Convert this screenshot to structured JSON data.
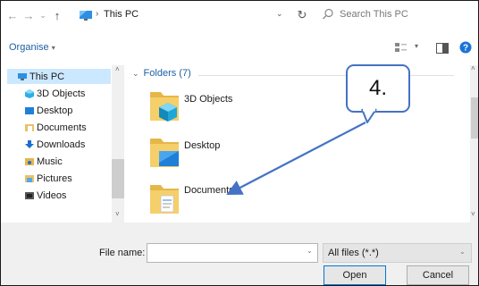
{
  "address": {
    "path": "This PC",
    "search_placeholder": "Search This PC"
  },
  "toolbar": {
    "organise_label": "Organise"
  },
  "nav": {
    "items": [
      {
        "label": "This PC"
      },
      {
        "label": "3D Objects"
      },
      {
        "label": "Desktop"
      },
      {
        "label": "Documents"
      },
      {
        "label": "Downloads"
      },
      {
        "label": "Music"
      },
      {
        "label": "Pictures"
      },
      {
        "label": "Videos"
      }
    ]
  },
  "content": {
    "group_header": "Folders (7)",
    "folders": [
      {
        "label": "3D Objects"
      },
      {
        "label": "Desktop"
      },
      {
        "label": "Documents"
      }
    ]
  },
  "bottom": {
    "file_name_label": "File name:",
    "file_name_value": "",
    "file_type_value": "All files (*.*)",
    "open_label": "Open",
    "cancel_label": "Cancel"
  },
  "annotation": {
    "callout_text": "4."
  },
  "colors": {
    "accent": "#1d5fa3",
    "annotation": "#4472c4",
    "selected": "#cce8ff"
  },
  "icons": [
    "back-arrow-icon",
    "forward-arrow-icon",
    "recent-chevron-icon",
    "up-arrow-icon",
    "this-pc-icon",
    "chevron-right-icon",
    "chevron-down-icon",
    "refresh-icon",
    "search-icon",
    "view-options-icon",
    "preview-pane-icon",
    "help-icon",
    "folder-icon"
  ]
}
